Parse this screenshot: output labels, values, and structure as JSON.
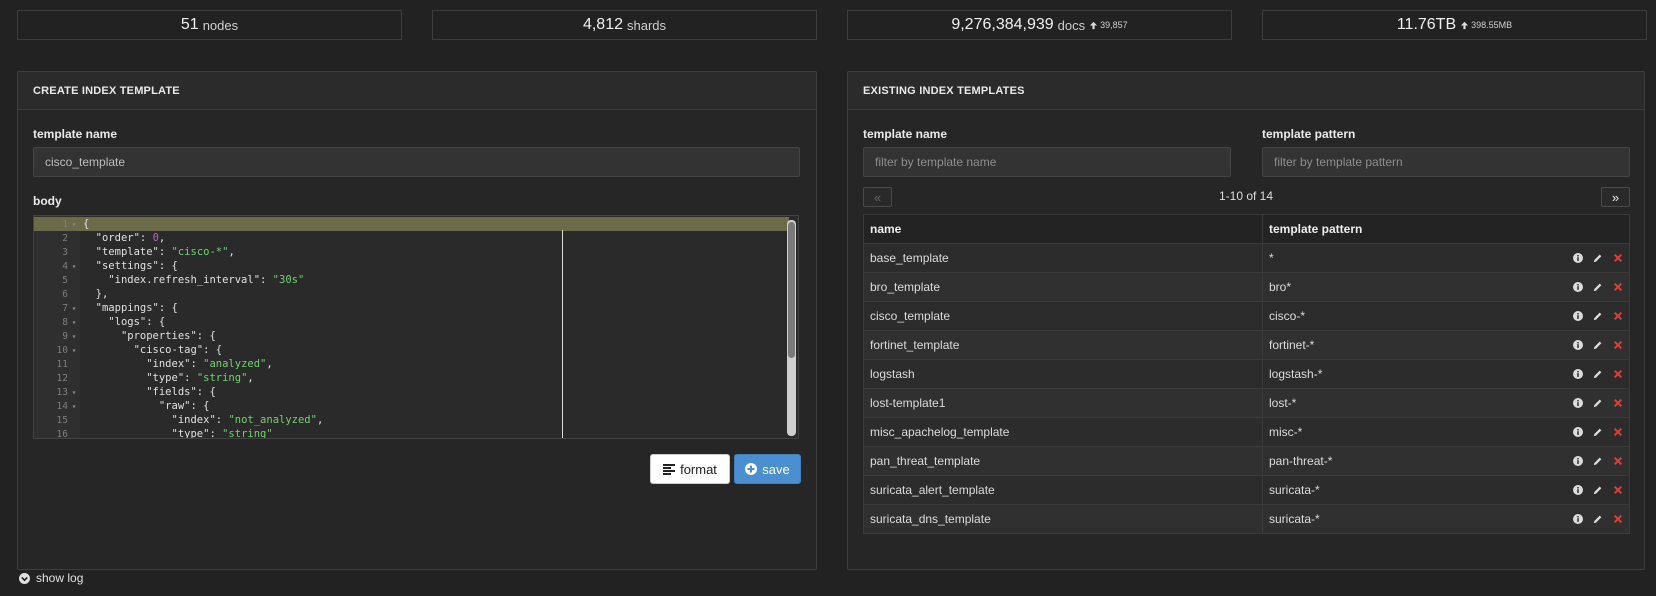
{
  "stats": {
    "nodes": {
      "value": "51",
      "label": "nodes"
    },
    "shards": {
      "value": "4,812",
      "label": "shards"
    },
    "docs": {
      "value": "9,276,384,939",
      "label": "docs",
      "delta": "39,857"
    },
    "size": {
      "value": "11.76TB",
      "delta": "398.55MB"
    }
  },
  "create_panel": {
    "title": "CREATE INDEX TEMPLATE",
    "name_label": "template name",
    "name_value": "cisco_template",
    "body_label": "body",
    "format_label": "format",
    "save_label": "save"
  },
  "editor": {
    "lines": [
      {
        "n": "1",
        "fold": true,
        "code": [
          [
            "p",
            "{"
          ]
        ]
      },
      {
        "n": "2",
        "fold": false,
        "code": [
          [
            "p",
            "  "
          ],
          [
            "k",
            "\"order\""
          ],
          [
            "p",
            ": "
          ],
          [
            "n",
            "0"
          ],
          [
            "p",
            ","
          ]
        ]
      },
      {
        "n": "3",
        "fold": false,
        "code": [
          [
            "p",
            "  "
          ],
          [
            "k",
            "\"template\""
          ],
          [
            "p",
            ": "
          ],
          [
            "s",
            "\"cisco-*\""
          ],
          [
            "p",
            ","
          ]
        ]
      },
      {
        "n": "4",
        "fold": true,
        "code": [
          [
            "p",
            "  "
          ],
          [
            "k",
            "\"settings\""
          ],
          [
            "p",
            ": {"
          ]
        ]
      },
      {
        "n": "5",
        "fold": false,
        "code": [
          [
            "p",
            "    "
          ],
          [
            "k",
            "\"index.refresh_interval\""
          ],
          [
            "p",
            ": "
          ],
          [
            "s",
            "\"30s\""
          ]
        ]
      },
      {
        "n": "6",
        "fold": false,
        "code": [
          [
            "p",
            "  },"
          ]
        ]
      },
      {
        "n": "7",
        "fold": true,
        "code": [
          [
            "p",
            "  "
          ],
          [
            "k",
            "\"mappings\""
          ],
          [
            "p",
            ": {"
          ]
        ]
      },
      {
        "n": "8",
        "fold": true,
        "code": [
          [
            "p",
            "    "
          ],
          [
            "k",
            "\"logs\""
          ],
          [
            "p",
            ": {"
          ]
        ]
      },
      {
        "n": "9",
        "fold": true,
        "code": [
          [
            "p",
            "      "
          ],
          [
            "k",
            "\"properties\""
          ],
          [
            "p",
            ": {"
          ]
        ]
      },
      {
        "n": "10",
        "fold": true,
        "code": [
          [
            "p",
            "        "
          ],
          [
            "k",
            "\"cisco-tag\""
          ],
          [
            "p",
            ": {"
          ]
        ]
      },
      {
        "n": "11",
        "fold": false,
        "code": [
          [
            "p",
            "          "
          ],
          [
            "k",
            "\"index\""
          ],
          [
            "p",
            ": "
          ],
          [
            "s",
            "\"analyzed\""
          ],
          [
            "p",
            ","
          ]
        ]
      },
      {
        "n": "12",
        "fold": false,
        "code": [
          [
            "p",
            "          "
          ],
          [
            "k",
            "\"type\""
          ],
          [
            "p",
            ": "
          ],
          [
            "s",
            "\"string\""
          ],
          [
            "p",
            ","
          ]
        ]
      },
      {
        "n": "13",
        "fold": true,
        "code": [
          [
            "p",
            "          "
          ],
          [
            "k",
            "\"fields\""
          ],
          [
            "p",
            ": {"
          ]
        ]
      },
      {
        "n": "14",
        "fold": true,
        "code": [
          [
            "p",
            "            "
          ],
          [
            "k",
            "\"raw\""
          ],
          [
            "p",
            ": {"
          ]
        ]
      },
      {
        "n": "15",
        "fold": false,
        "code": [
          [
            "p",
            "              "
          ],
          [
            "k",
            "\"index\""
          ],
          [
            "p",
            ": "
          ],
          [
            "s",
            "\"not_analyzed\""
          ],
          [
            "p",
            ","
          ]
        ]
      },
      {
        "n": "16",
        "fold": false,
        "code": [
          [
            "p",
            "              "
          ],
          [
            "k",
            "\"type\""
          ],
          [
            "p",
            ": "
          ],
          [
            "s",
            "\"string\""
          ]
        ]
      }
    ]
  },
  "existing_panel": {
    "title": "EXISTING INDEX TEMPLATES",
    "filter_name_label": "template name",
    "filter_name_placeholder": "filter by template name",
    "filter_pattern_label": "template pattern",
    "filter_pattern_placeholder": "filter by template pattern",
    "pager_prev": "«",
    "pager_next": "»",
    "pager_info": "1-10 of 14",
    "columns": [
      "name",
      "template pattern"
    ],
    "rows": [
      {
        "name": "base_template",
        "pattern": "*"
      },
      {
        "name": "bro_template",
        "pattern": "bro*"
      },
      {
        "name": "cisco_template",
        "pattern": "cisco-*"
      },
      {
        "name": "fortinet_template",
        "pattern": "fortinet-*"
      },
      {
        "name": "logstash",
        "pattern": "logstash-*"
      },
      {
        "name": "lost-template1",
        "pattern": "lost-*"
      },
      {
        "name": "misc_apachelog_template",
        "pattern": "misc-*"
      },
      {
        "name": "pan_threat_template",
        "pattern": "pan-threat-*"
      },
      {
        "name": "suricata_alert_template",
        "pattern": "suricata-*"
      },
      {
        "name": "suricata_dns_template",
        "pattern": "suricata-*"
      }
    ]
  },
  "footer": {
    "show_log_label": "show log"
  },
  "colors": {
    "background": "#222222",
    "accent_blue": "#4a90d0",
    "delete_red": "#d9413b",
    "string_green": "#6fd36f",
    "number_purple": "#c35fc3"
  }
}
